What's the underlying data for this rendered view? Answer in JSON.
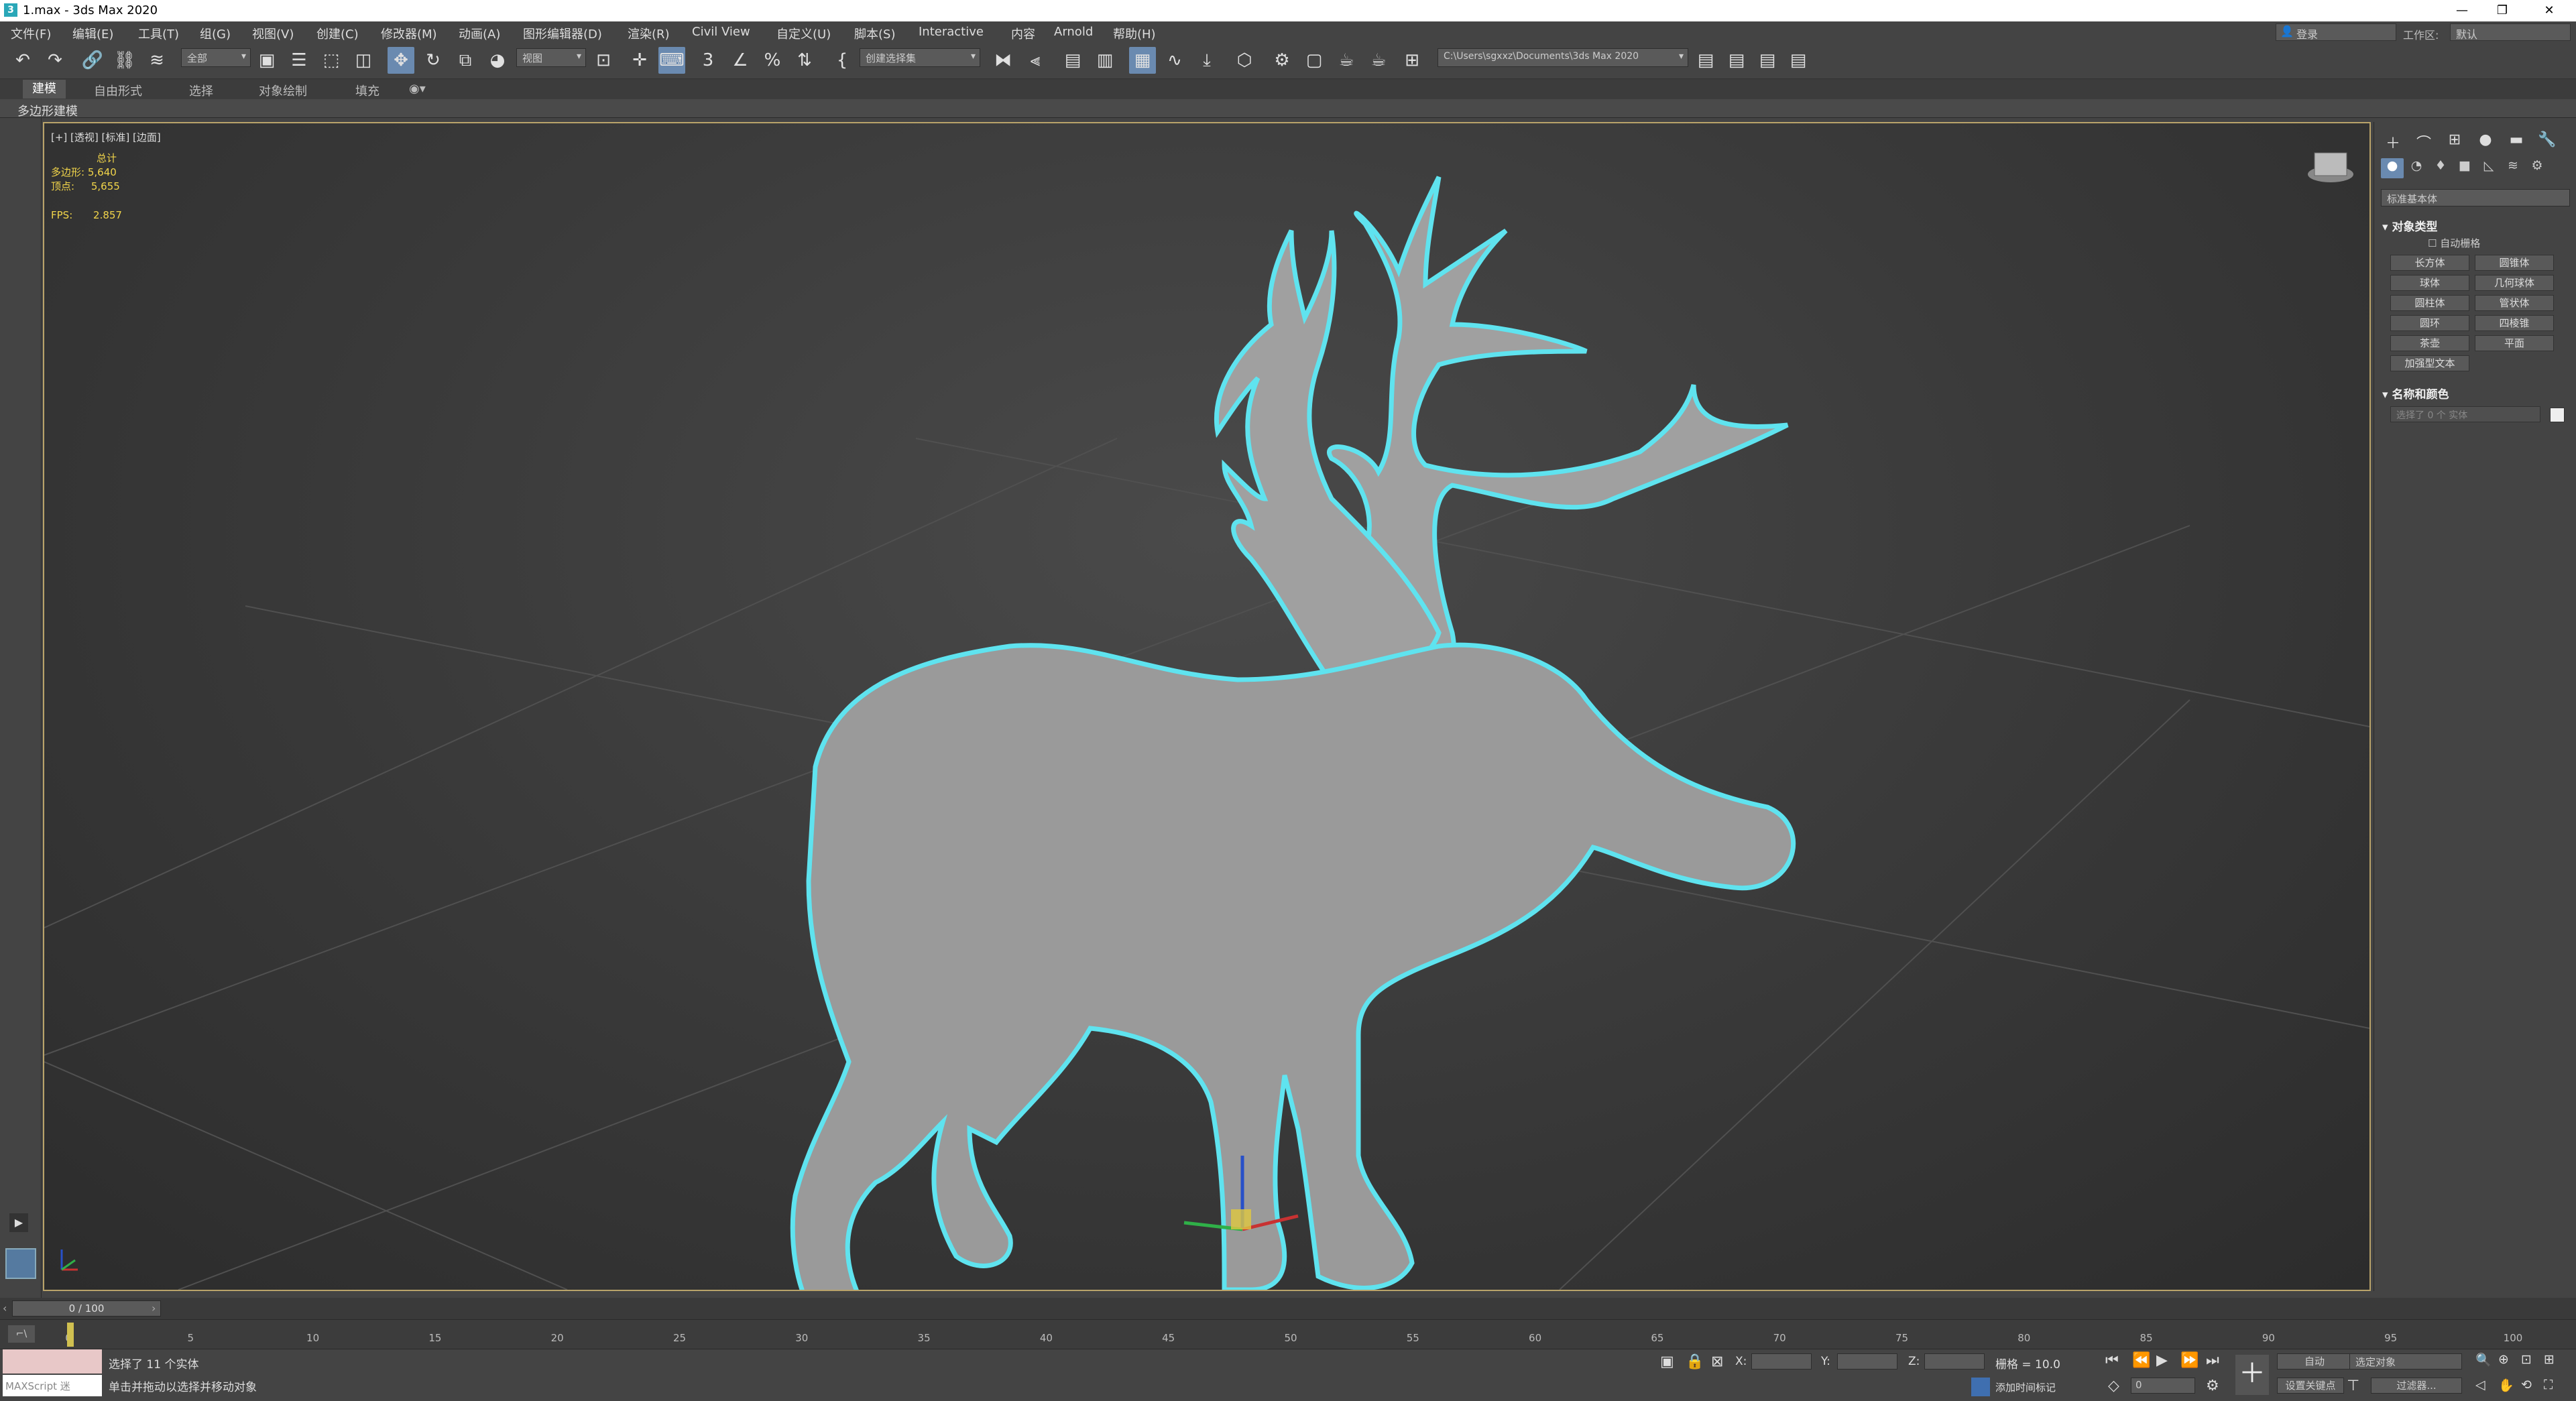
{
  "window": {
    "title": "1.max - 3ds Max 2020",
    "minimize": "—",
    "maximize": "❐",
    "close": "✕"
  },
  "menubar": {
    "items": [
      "文件(F)",
      "编辑(E)",
      "工具(T)",
      "组(G)",
      "视图(V)",
      "创建(C)",
      "修改器(M)",
      "动画(A)",
      "图形编辑器(D)",
      "渲染(R)",
      "Civil View",
      "自定义(U)",
      "脚本(S)",
      "Interactive",
      "内容",
      "Arnold",
      "帮助(H)"
    ],
    "login": "登录",
    "workspace_label": "工作区:",
    "workspace_value": "默认"
  },
  "toolbar": {
    "selection_filter": "全部",
    "ref_coord": "视图",
    "named_selection": "创建选择集",
    "project_path": "C:\\Users\\sgxxz\\Documents\\3ds Max 2020"
  },
  "ribbon": {
    "tabs": [
      "建模",
      "自由形式",
      "选择",
      "对象绘制",
      "填充"
    ],
    "panel_label": "多边形建模"
  },
  "viewport": {
    "label": "[+] [透视] [标准] [边面]",
    "total_label": "总计",
    "poly_label": "多边形:",
    "poly_value": "5,640",
    "vert_label": "顶点:",
    "vert_value": "5,655",
    "fps_label": "FPS:",
    "fps_value": "2.857"
  },
  "command_panel": {
    "category": "标准基本体",
    "object_type_title": "对象类型",
    "autogrid": "自动栅格",
    "buttons": [
      "长方体",
      "圆锥体",
      "球体",
      "几何球体",
      "圆柱体",
      "管状体",
      "圆环",
      "四棱锥",
      "茶壶",
      "平面",
      "加强型文本"
    ],
    "name_color_title": "名称和颜色",
    "name_value": "选择了 0 个 实体"
  },
  "timeline": {
    "slider_text": "0 / 100",
    "ticks": [
      "0",
      "5",
      "10",
      "15",
      "20",
      "25",
      "30",
      "35",
      "40",
      "45",
      "50",
      "55",
      "60",
      "65",
      "70",
      "75",
      "80",
      "85",
      "90",
      "95",
      "100"
    ]
  },
  "status": {
    "maxscript": "MAXScript 迷",
    "selection_msg": "选择了 11 个实体",
    "prompt": "单击并拖动以选择并移动对象",
    "x_label": "X:",
    "y_label": "Y:",
    "z_label": "Z:",
    "grid": "栅格 = 10.0",
    "add_time_tag": "添加时间标记",
    "auto_key": "自动",
    "selected_object": "选定对象",
    "set_key": "设置关键点",
    "key_filters": "过滤器...",
    "frame": "0"
  },
  "colors": {
    "selection_outline": "#5fe3ef",
    "mesh_fill": "#9a9a9a",
    "active_blue": "#6a8ab0"
  }
}
